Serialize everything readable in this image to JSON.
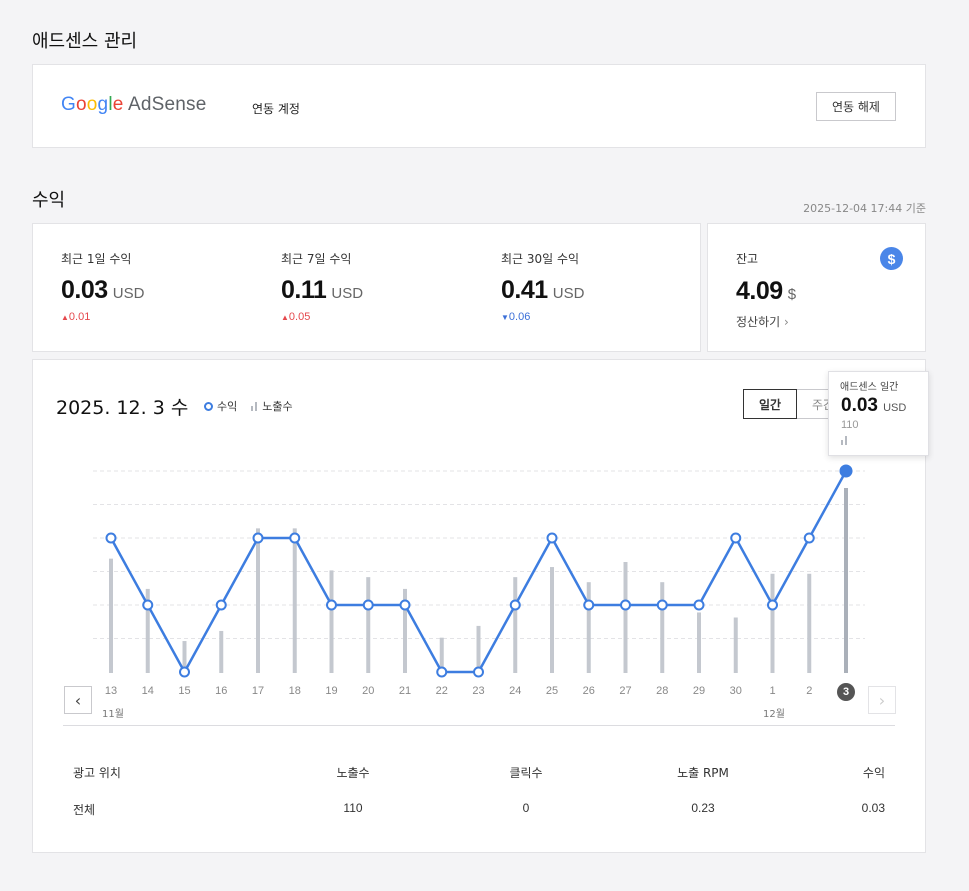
{
  "adsense_section": {
    "title": "애드센스 관리",
    "logo_google": "Google",
    "logo_adsense": "AdSense",
    "account_label": "연동 계정",
    "unlink_button": "연동 해제"
  },
  "revenue_section": {
    "title": "수익",
    "timestamp": "2025-12-04 17:44 기준"
  },
  "stats": [
    {
      "label": "최근 1일 수익",
      "value": "0.03",
      "unit": "USD",
      "delta": "0.01",
      "direction": "up"
    },
    {
      "label": "최근 7일 수익",
      "value": "0.11",
      "unit": "USD",
      "delta": "0.05",
      "direction": "up"
    },
    {
      "label": "최근 30일 수익",
      "value": "0.41",
      "unit": "USD",
      "delta": "0.06",
      "direction": "down"
    }
  ],
  "balance": {
    "label": "잔고",
    "value": "4.09",
    "unit": "$",
    "settle_link": "정산하기",
    "icon": "dollar-icon"
  },
  "chart_panel": {
    "date_title": "2025. 12. 3 수",
    "legend_revenue": "수익",
    "legend_impressions": "노출수",
    "tab_daily": "일간",
    "tab_weekly": "주간",
    "month_label_nov": "11월",
    "month_label_dec": "12월"
  },
  "tooltip": {
    "title": "애드센스 일간",
    "value": "0.03",
    "unit": "USD",
    "impressions": "110"
  },
  "chart_data": {
    "type": "line",
    "x": [
      "13",
      "14",
      "15",
      "16",
      "17",
      "18",
      "19",
      "20",
      "21",
      "22",
      "23",
      "24",
      "25",
      "26",
      "27",
      "28",
      "29",
      "30",
      "1",
      "2",
      "3"
    ],
    "series": [
      {
        "name": "수익",
        "values": [
          0.02,
          0.01,
          0.0,
          0.01,
          0.02,
          0.02,
          0.01,
          0.01,
          0.01,
          0.0,
          0.0,
          0.01,
          0.02,
          0.01,
          0.01,
          0.01,
          0.01,
          0.02,
          0.01,
          0.02,
          0.03
        ],
        "color": "#3d7de0"
      },
      {
        "name": "노출수",
        "type": "bar",
        "values": [
          68,
          50,
          19,
          25,
          86,
          86,
          61,
          57,
          50,
          21,
          28,
          57,
          63,
          54,
          66,
          54,
          36,
          33,
          59,
          59,
          110
        ],
        "color": "#c4c8cf"
      }
    ],
    "selected_index": 20,
    "grid": true
  },
  "table": {
    "headers": [
      "광고 위치",
      "노출수",
      "클릭수",
      "노출 RPM",
      "수익"
    ],
    "rows": [
      [
        "전체",
        "110",
        "0",
        "0.23",
        "0.03"
      ]
    ]
  },
  "colors": {
    "accent": "#3d7de0",
    "up": "#e5484d",
    "down": "#3b6fd8"
  }
}
